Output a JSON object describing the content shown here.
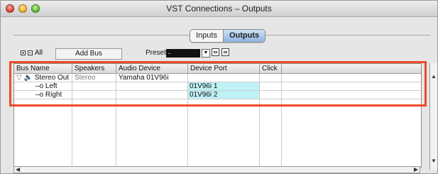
{
  "window": {
    "title": "VST Connections – Outputs"
  },
  "tabs": [
    {
      "label": "Inputs"
    },
    {
      "label": "Outputs"
    }
  ],
  "toolbar": {
    "all_label": "All",
    "add_bus_label": "Add Bus",
    "presets_label": "Presets",
    "presets_value": "-"
  },
  "table": {
    "columns": [
      "Bus Name",
      "Speakers",
      "Audio Device",
      "Device Port",
      "Click"
    ],
    "rows": [
      {
        "bus_name": "Stereo Out",
        "speakers": "Stereo",
        "audio_device": "Yamaha 01V96i",
        "device_port": "",
        "click": ""
      },
      {
        "bus_name": "Left",
        "speakers": "",
        "audio_device": "",
        "device_port": "01V96i 1",
        "click": ""
      },
      {
        "bus_name": "Right",
        "speakers": "",
        "audio_device": "",
        "device_port": "01V96i 2",
        "click": ""
      }
    ]
  },
  "colors": {
    "highlight": "#ee4b2b",
    "port_cell": "#bff1f5",
    "active_tab": "#8fb3df"
  },
  "icons": {
    "expand_all": "plus-square-icon",
    "collapse_all": "minus-square-icon",
    "disclosure": "triangle-down-icon",
    "speaker": "speaker-icon",
    "port": "port-connector-icon",
    "save_preset": "save-preset-icon",
    "delete_preset": "delete-preset-icon"
  }
}
